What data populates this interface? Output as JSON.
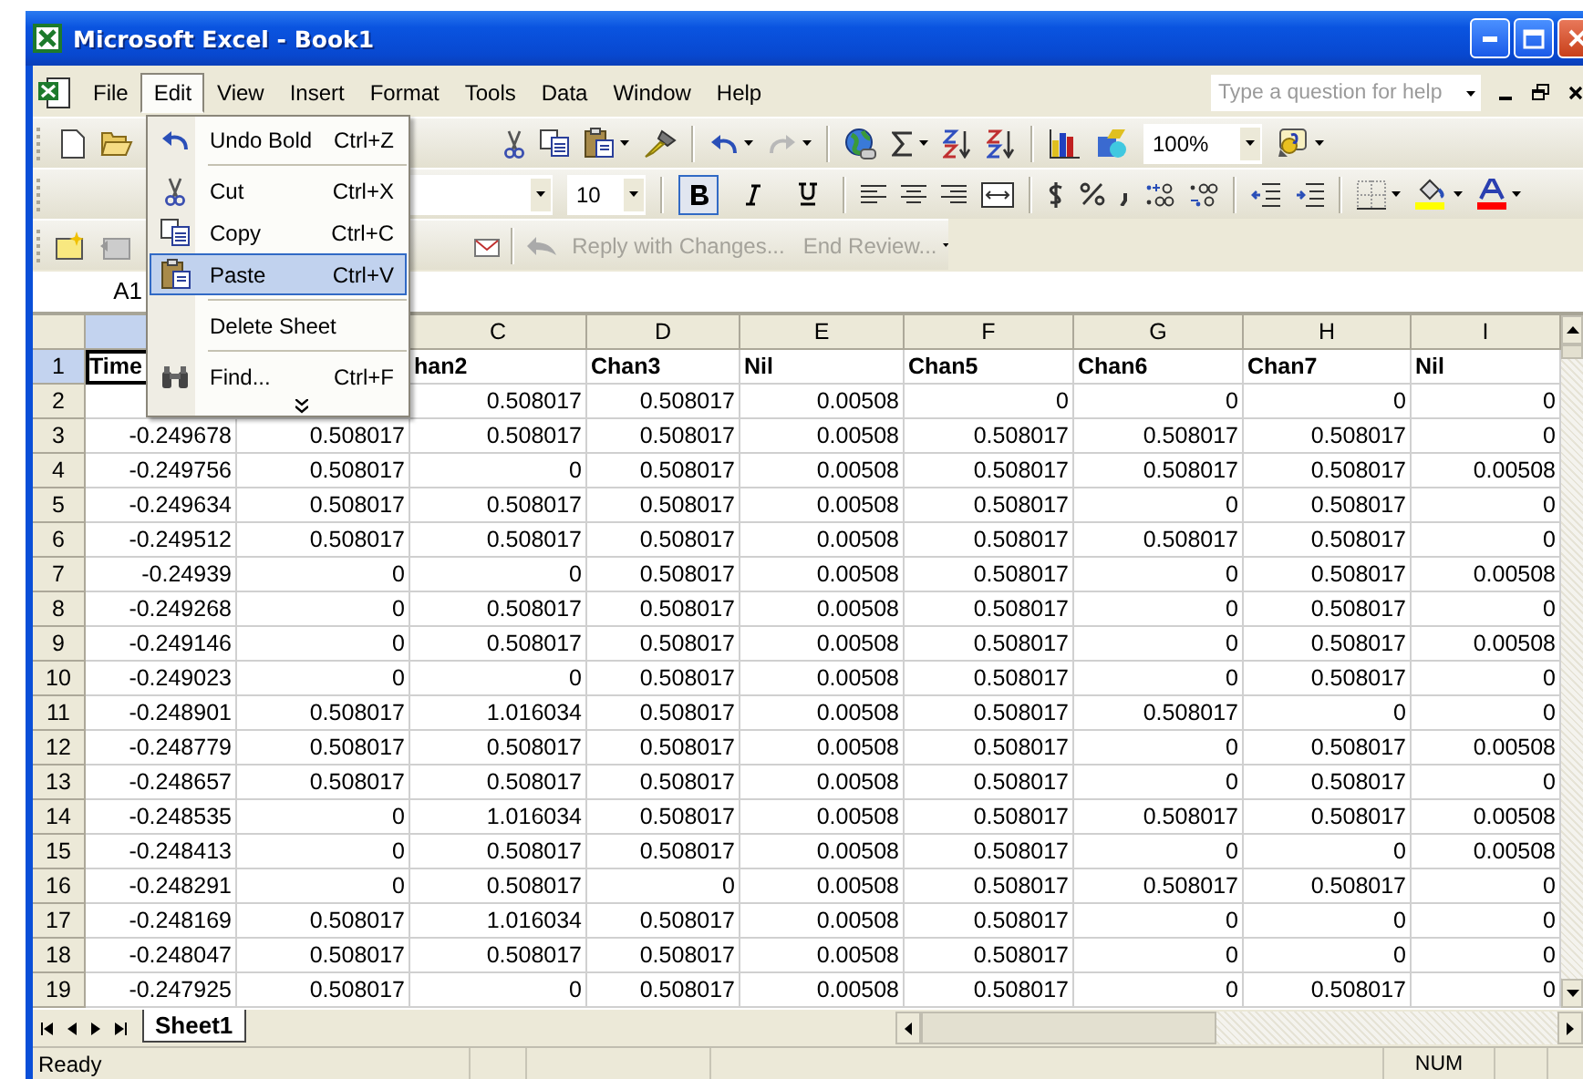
{
  "window": {
    "title": "Microsoft Excel - Book1"
  },
  "menu_bar": [
    {
      "label": "File",
      "selected": false
    },
    {
      "label": "Edit",
      "selected": true
    },
    {
      "label": "View",
      "selected": false
    },
    {
      "label": "Insert",
      "selected": false
    },
    {
      "label": "Format",
      "selected": false
    },
    {
      "label": "Tools",
      "selected": false
    },
    {
      "label": "Data",
      "selected": false
    },
    {
      "label": "Window",
      "selected": false
    },
    {
      "label": "Help",
      "selected": false
    }
  ],
  "help_box": {
    "placeholder": "Type a question for help"
  },
  "standard_toolbar": {
    "zoom": "100%"
  },
  "formatting_toolbar": {
    "font_size": "10",
    "bold": true,
    "italic": false,
    "underline": false
  },
  "reviewing_toolbar": {
    "buttons": [
      {
        "label": "Reply with Changes...",
        "disabled": true
      },
      {
        "label": "End Review...",
        "disabled": true
      }
    ]
  },
  "name_box": "A1",
  "edit_menu": [
    {
      "kind": "item",
      "label": "Undo Bold",
      "shortcut": "Ctrl+Z",
      "selected": false
    },
    {
      "kind": "separator"
    },
    {
      "kind": "item",
      "label": "Cut",
      "shortcut": "Ctrl+X",
      "selected": false
    },
    {
      "kind": "item",
      "label": "Copy",
      "shortcut": "Ctrl+C",
      "selected": false
    },
    {
      "kind": "item",
      "label": "Paste",
      "shortcut": "Ctrl+V",
      "selected": true
    },
    {
      "kind": "separator"
    },
    {
      "kind": "item",
      "label": "Delete Sheet",
      "selected": false
    },
    {
      "kind": "separator"
    },
    {
      "kind": "item",
      "label": "Find...",
      "shortcut": "Ctrl+F",
      "selected": false
    },
    {
      "kind": "expand"
    }
  ],
  "columns": [
    {
      "selected": true
    },
    null,
    {
      "label": "C",
      "selected": false
    },
    {
      "label": "D",
      "selected": false
    },
    {
      "label": "E",
      "selected": false
    },
    {
      "label": "F",
      "selected": false
    },
    {
      "label": "G",
      "selected": false
    },
    {
      "label": "H",
      "selected": false
    },
    {
      "label": "I",
      "selected": false
    }
  ],
  "rows": [
    {
      "number": "1",
      "selected": true,
      "kind": "header",
      "cells": [
        "Time",
        null,
        "han2",
        "Chan3",
        "Nil",
        "Chan5",
        "Chan6",
        "Chan7",
        "Nil"
      ]
    },
    {
      "number": "2",
      "selected": false,
      "kind": "data",
      "cells": [
        null,
        null,
        "0.508017",
        "0.508017",
        "0.00508",
        "0",
        "0",
        "0",
        "0"
      ]
    },
    {
      "number": "3",
      "selected": false,
      "kind": "data",
      "cells": [
        "-0.249678",
        "0.508017",
        "0.508017",
        "0.508017",
        "0.00508",
        "0.508017",
        "0.508017",
        "0.508017",
        "0"
      ]
    },
    {
      "number": "4",
      "selected": false,
      "kind": "data",
      "cells": [
        "-0.249756",
        "0.508017",
        "0",
        "0.508017",
        "0.00508",
        "0.508017",
        "0.508017",
        "0.508017",
        "0.00508"
      ]
    },
    {
      "number": "5",
      "selected": false,
      "kind": "data",
      "cells": [
        "-0.249634",
        "0.508017",
        "0.508017",
        "0.508017",
        "0.00508",
        "0.508017",
        "0",
        "0.508017",
        "0"
      ]
    },
    {
      "number": "6",
      "selected": false,
      "kind": "data",
      "cells": [
        "-0.249512",
        "0.508017",
        "0.508017",
        "0.508017",
        "0.00508",
        "0.508017",
        "0.508017",
        "0.508017",
        "0"
      ]
    },
    {
      "number": "7",
      "selected": false,
      "kind": "data",
      "cells": [
        "-0.24939",
        "0",
        "0",
        "0.508017",
        "0.00508",
        "0.508017",
        "0",
        "0.508017",
        "0.00508"
      ]
    },
    {
      "number": "8",
      "selected": false,
      "kind": "data",
      "cells": [
        "-0.249268",
        "0",
        "0.508017",
        "0.508017",
        "0.00508",
        "0.508017",
        "0",
        "0.508017",
        "0"
      ]
    },
    {
      "number": "9",
      "selected": false,
      "kind": "data",
      "cells": [
        "-0.249146",
        "0",
        "0.508017",
        "0.508017",
        "0.00508",
        "0.508017",
        "0",
        "0.508017",
        "0.00508"
      ]
    },
    {
      "number": "10",
      "selected": false,
      "kind": "data",
      "cells": [
        "-0.249023",
        "0",
        "0",
        "0.508017",
        "0.00508",
        "0.508017",
        "0",
        "0.508017",
        "0"
      ]
    },
    {
      "number": "11",
      "selected": false,
      "kind": "data",
      "cells": [
        "-0.248901",
        "0.508017",
        "1.016034",
        "0.508017",
        "0.00508",
        "0.508017",
        "0.508017",
        "0",
        "0"
      ]
    },
    {
      "number": "12",
      "selected": false,
      "kind": "data",
      "cells": [
        "-0.248779",
        "0.508017",
        "0.508017",
        "0.508017",
        "0.00508",
        "0.508017",
        "0",
        "0.508017",
        "0.00508"
      ]
    },
    {
      "number": "13",
      "selected": false,
      "kind": "data",
      "cells": [
        "-0.248657",
        "0.508017",
        "0.508017",
        "0.508017",
        "0.00508",
        "0.508017",
        "0",
        "0.508017",
        "0"
      ]
    },
    {
      "number": "14",
      "selected": false,
      "kind": "data",
      "cells": [
        "-0.248535",
        "0",
        "1.016034",
        "0.508017",
        "0.00508",
        "0.508017",
        "0.508017",
        "0.508017",
        "0.00508"
      ]
    },
    {
      "number": "15",
      "selected": false,
      "kind": "data",
      "cells": [
        "-0.248413",
        "0",
        "0.508017",
        "0.508017",
        "0.00508",
        "0.508017",
        "0",
        "0",
        "0.00508"
      ]
    },
    {
      "number": "16",
      "selected": false,
      "kind": "data",
      "cells": [
        "-0.248291",
        "0",
        "0.508017",
        "0",
        "0.00508",
        "0.508017",
        "0.508017",
        "0.508017",
        "0"
      ]
    },
    {
      "number": "17",
      "selected": false,
      "kind": "data",
      "cells": [
        "-0.248169",
        "0.508017",
        "1.016034",
        "0.508017",
        "0.00508",
        "0.508017",
        "0",
        "0",
        "0"
      ]
    },
    {
      "number": "18",
      "selected": false,
      "kind": "data",
      "cells": [
        "-0.248047",
        "0.508017",
        "0.508017",
        "0.508017",
        "0.00508",
        "0.508017",
        "0",
        "0",
        "0"
      ]
    },
    {
      "number": "19",
      "selected": false,
      "kind": "data",
      "cells": [
        "-0.247925",
        "0.508017",
        "0",
        "0.508017",
        "0.00508",
        "0.508017",
        "0",
        "0.508017",
        "0"
      ]
    }
  ],
  "sheet_tabs": [
    "Sheet1"
  ],
  "status_bar": {
    "message": "Ready",
    "indicator": "NUM"
  }
}
